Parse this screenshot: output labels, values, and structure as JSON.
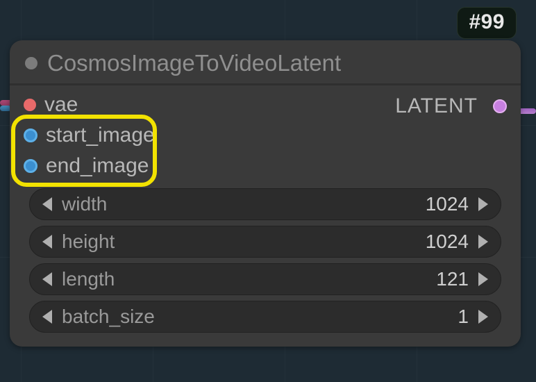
{
  "badge": "#99",
  "node": {
    "title": "CosmosImageToVideoLatent",
    "inputs": [
      {
        "name": "vae",
        "kind": "vae"
      },
      {
        "name": "start_image",
        "kind": "img"
      },
      {
        "name": "end_image",
        "kind": "img"
      }
    ],
    "outputs": [
      {
        "name": "LATENT",
        "kind": "latent"
      }
    ],
    "widgets": [
      {
        "name": "width",
        "value": "1024"
      },
      {
        "name": "height",
        "value": "1024"
      },
      {
        "name": "length",
        "value": "121"
      },
      {
        "name": "batch_size",
        "value": "1"
      }
    ]
  },
  "highlight_inputs": [
    "start_image",
    "end_image"
  ]
}
